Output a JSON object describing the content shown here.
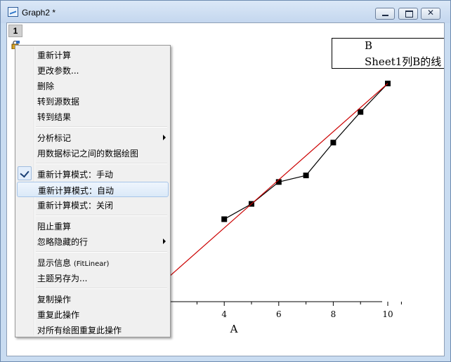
{
  "window": {
    "title": "Graph2 *",
    "minimize_icon": "minimize-icon",
    "maximize_icon": "maximize-icon",
    "close_glyph": "✕"
  },
  "layer": {
    "number": "1"
  },
  "legend": {
    "items": [
      {
        "label": "B",
        "symbol": "line-square",
        "color": "#000000"
      },
      {
        "label": "Sheet1列B的线",
        "symbol": "line",
        "color": "#cc0000"
      }
    ]
  },
  "chart_data": {
    "type": "scatter",
    "xlabel": "A",
    "ylabel": "",
    "xlim": [
      0,
      11
    ],
    "ylim": [
      -20,
      96
    ],
    "x_ticks": [
      "4",
      "6",
      "8",
      "10"
    ],
    "series": [
      {
        "name": "B",
        "style": "line+symbol",
        "color": "#000000",
        "x": [
          4,
          5,
          6,
          7,
          8,
          9,
          10
        ],
        "y": [
          38,
          45,
          55,
          58,
          73,
          87,
          100
        ]
      },
      {
        "name": "Sheet1列B的线",
        "style": "line",
        "color": "#cc0000",
        "x": [
          0,
          10
        ],
        "y": [
          -10,
          100
        ]
      }
    ],
    "legend_position": "top-right"
  },
  "menu": {
    "groups": [
      [
        {
          "label": "重新计算"
        },
        {
          "label": "更改参数..."
        },
        {
          "label": "删除"
        },
        {
          "label": "转到源数据"
        },
        {
          "label": "转到结果"
        }
      ],
      [
        {
          "label": "分析标记",
          "submenu": true
        },
        {
          "label": "用数据标记之间的数据绘图"
        }
      ],
      [
        {
          "label": "重新计算模式：手动",
          "checked": true
        },
        {
          "label": "重新计算模式：自动",
          "highlighted": true
        },
        {
          "label": "重新计算模式：关闭"
        }
      ],
      [
        {
          "label": "阻止重算"
        },
        {
          "label": "忽略隐藏的行",
          "submenu": true
        }
      ],
      [
        {
          "label": "显示信息 ",
          "suffix": "(FitLinear)"
        },
        {
          "label": "主题另存为..."
        }
      ],
      [
        {
          "label": "复制操作"
        },
        {
          "label": "重复此操作"
        },
        {
          "label": "对所有绘图重复此操作"
        }
      ]
    ]
  }
}
